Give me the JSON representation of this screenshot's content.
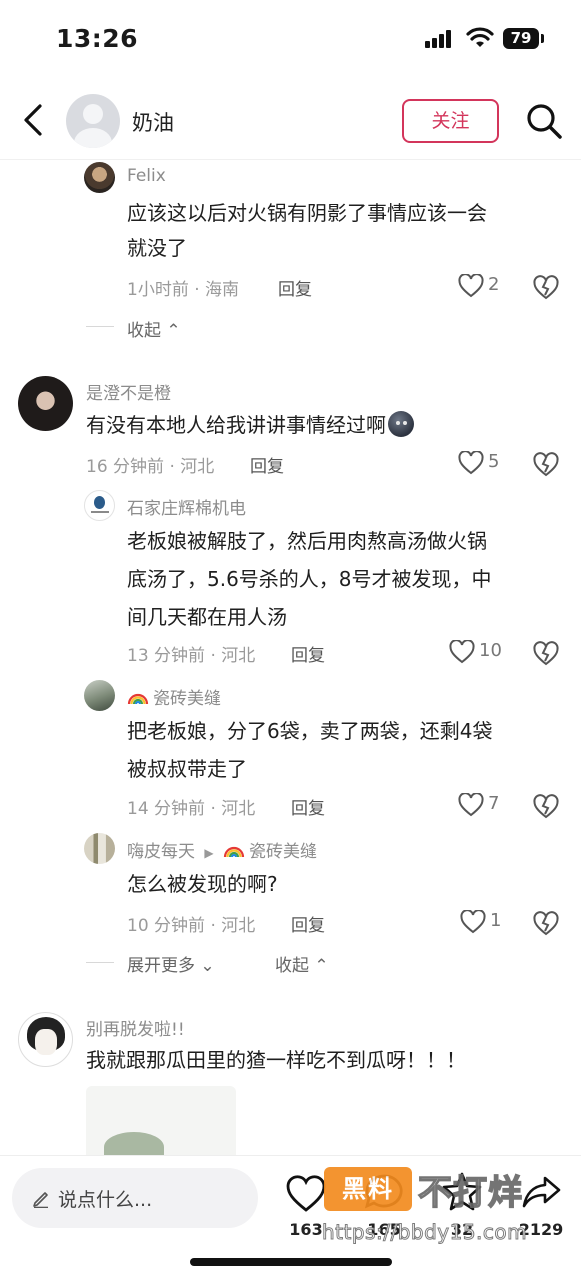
{
  "status_bar": {
    "time": "13:26",
    "battery": "79"
  },
  "header": {
    "name": "奶油",
    "follow_label": "关注"
  },
  "threads": [
    {
      "user": "Felix",
      "text_lines": [
        "应该这以后对火锅有阴影了事情应该一会",
        "就没了"
      ],
      "meta": "1小时前 · 海南",
      "reply_label": "回复",
      "likes": "2",
      "fold_label": "收起"
    },
    {
      "user": "是澄不是橙",
      "text": "有没有本地人给我讲讲事情经过啊",
      "meta": "16 分钟前 · 河北",
      "reply_label": "回复",
      "likes": "5"
    },
    {
      "user": "石家庄辉棉机电",
      "text_lines": [
        "老板娘被解肢了，然后用肉熬高汤做火锅",
        "底汤了，5.6号杀的人，8号才被发现，中",
        "间几天都在用人汤"
      ],
      "meta": "13 分钟前 · 河北",
      "reply_label": "回复",
      "likes": "10"
    },
    {
      "user": "瓷砖美缝",
      "text_lines": [
        "把老板娘，分了6袋，卖了两袋，还剩4袋",
        "被叔叔带走了"
      ],
      "meta": "14 分钟前 · 河北",
      "reply_label": "回复",
      "likes": "7"
    },
    {
      "user": "嗨皮每天",
      "reply_to": "瓷砖美缝",
      "text": "怎么被发现的啊?",
      "meta": "10 分钟前 · 河北",
      "reply_label": "回复",
      "likes": "1",
      "expand_label": "展开更多",
      "fold_label": "收起"
    },
    {
      "user": "别再脱发啦!!",
      "text": "我就跟那瓜田里的猹一样吃不到瓜呀！！！"
    }
  ],
  "bottom_bar": {
    "input_placeholder": "说点什么...",
    "likes": "163",
    "comments": "165",
    "favorites": "32",
    "shares": "2129"
  },
  "watermark": {
    "logo": "黑料",
    "text": "不打烊",
    "url": "https://bbdy15.com"
  },
  "colors": {
    "accent": "#d3355b",
    "text": "#1f1f1f",
    "muted": "#9a9a9a"
  }
}
